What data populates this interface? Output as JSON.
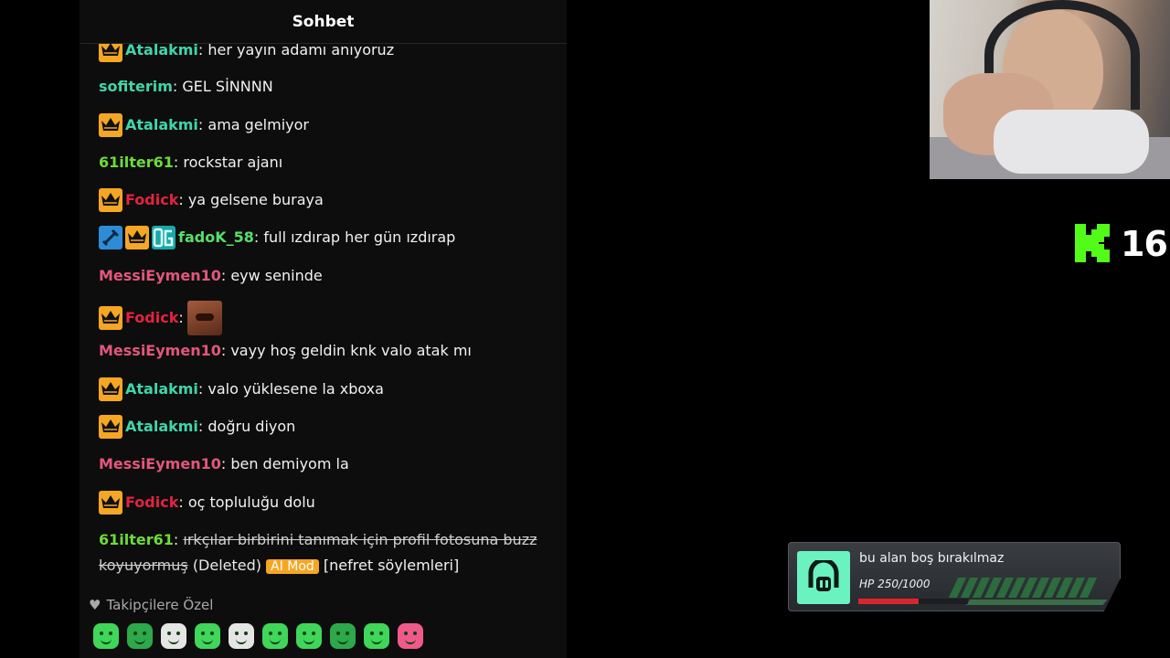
{
  "chat": {
    "title": "Sohbet",
    "messages": [
      {
        "user": "Atalakmi",
        "text": ": her yayın adamı anıyoruz"
      },
      {
        "user": "sofiterim",
        "text": ": GEL SİNNNN"
      },
      {
        "user": "Atalakmi",
        "text": ": ama gelmiyor"
      },
      {
        "user": "61ilter61",
        "text": ": rockstar ajanı"
      },
      {
        "user": "Fodick",
        "text": ": ya gelsene buraya"
      },
      {
        "user": "fadoK_58",
        "text": ": full ızdırap her gün ızdırap"
      },
      {
        "user": "MessiEymen10",
        "text": ": eyw seninde"
      },
      {
        "user": "Fodick",
        "text": ":"
      },
      {
        "user": "MessiEymen10",
        "text": ": vayy hoş geldin knk valo atak mı"
      },
      {
        "user": "Atalakmi",
        "text": ": valo yüklesene la xboxa"
      },
      {
        "user": "Atalakmi",
        "text": ": doğru diyon"
      },
      {
        "user": "MessiEymen10",
        "text": ": ben demiyom la"
      },
      {
        "user": "Fodick",
        "text": ": oç topluluğu dolu"
      },
      {
        "user": "61ilter61",
        "text": ": ",
        "struck": "ırkçılar birbirini tanımak için profil fotosuna buzz koyuyormuş",
        "deleted": "(Deleted)",
        "tag": "AI Mod",
        "reason": "[nefret söylemleri]"
      }
    ],
    "followers_only": "Takipçilere Özel",
    "emotes": [
      "emote-1",
      "emote-2",
      "emote-3",
      "emote-4",
      "emote-5",
      "emote-6",
      "emote-7",
      "emote-8",
      "emote-9",
      "emote-10"
    ]
  },
  "overlay": {
    "logo_number": "16",
    "hp_widget": {
      "title": "bu alan boş bırakılmaz",
      "hp_label": "HP 250/1000",
      "hp_current": 250,
      "hp_max": 1000
    }
  },
  "colors": {
    "crown_badge": "#f5a623",
    "kick_green": "#53fc18",
    "hp_icon": "#6bf2c1",
    "hp_fill": "#d8262c"
  }
}
